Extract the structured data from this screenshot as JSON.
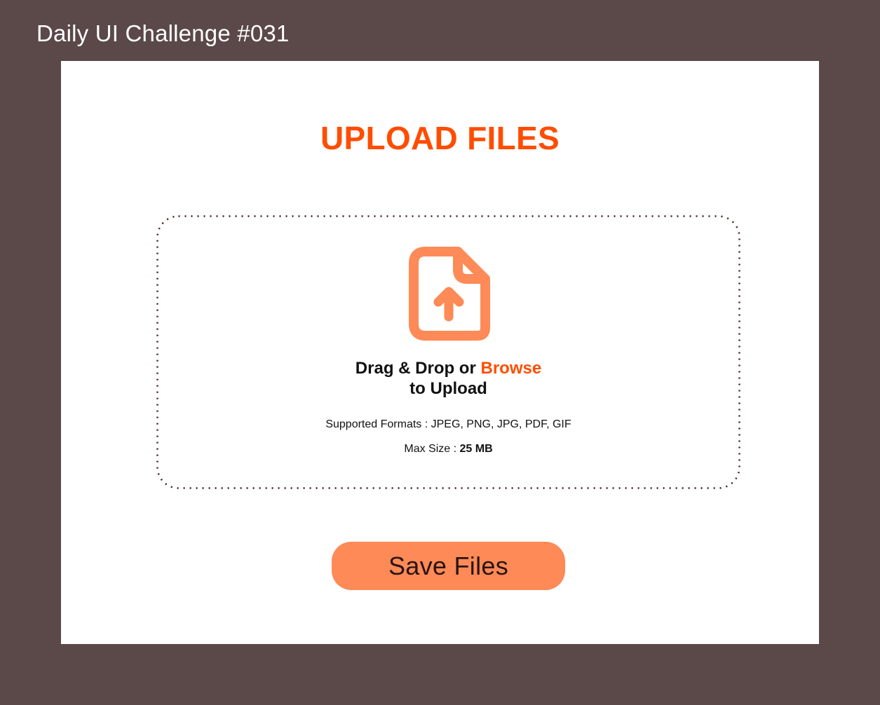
{
  "page": {
    "heading": "Daily UI Challenge #031"
  },
  "upload": {
    "title": "UPLOAD FILES",
    "drop_prefix": "Drag & Drop or ",
    "browse_label": "Browse",
    "drop_suffix": "to Upload",
    "formats_text": "Supported Formats : JPEG, PNG, JPG, PDF, GIF",
    "max_size_label": "Max Size : ",
    "max_size_value": "25 MB",
    "icon": "file-upload-icon"
  },
  "actions": {
    "save_label": "Save Files"
  },
  "colors": {
    "background": "#5b4848",
    "card": "#ffffff",
    "accent": "#ff4d00",
    "icon": "#fd8a57",
    "button": "#fd8a57",
    "button_text": "#2a1410",
    "dropzone_border": "#3a1f1a"
  }
}
